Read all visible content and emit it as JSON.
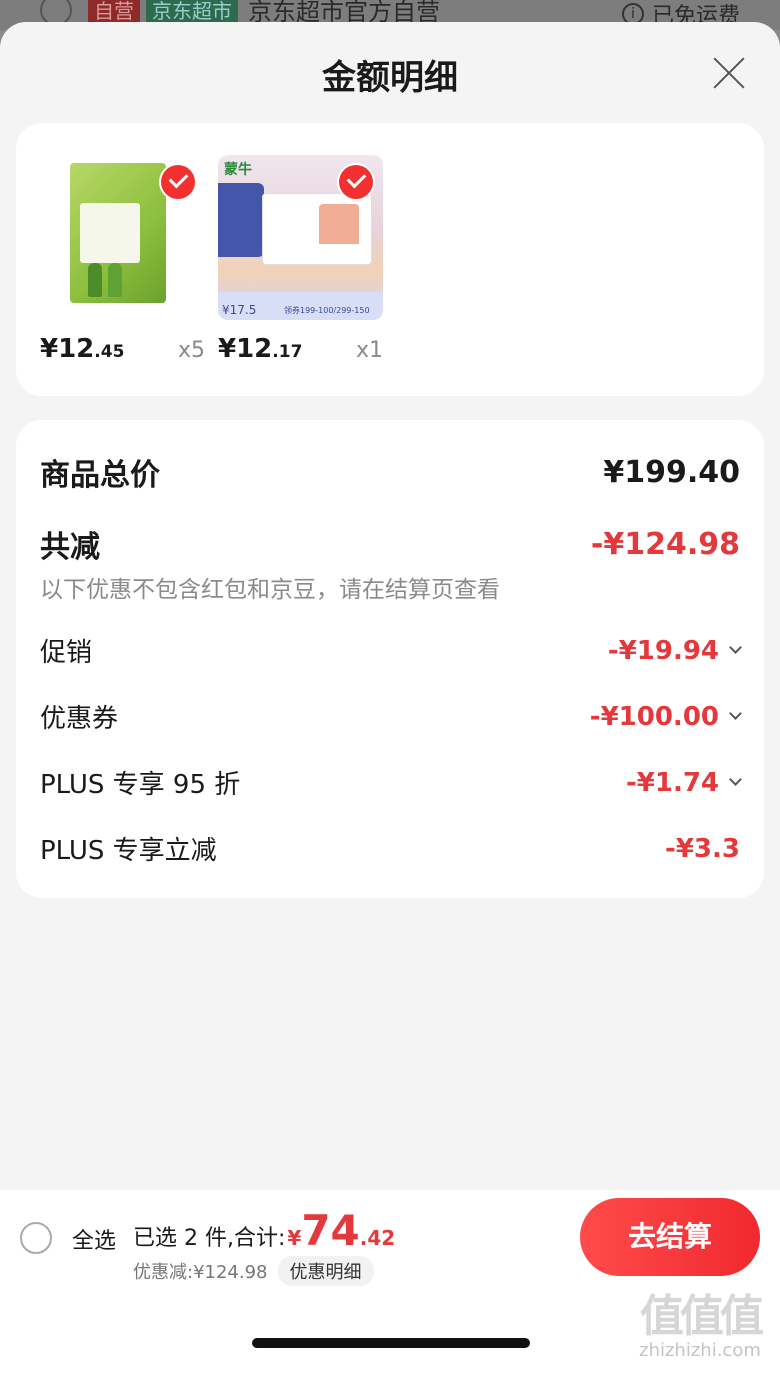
{
  "background": {
    "self_tag": "自营",
    "super_tag": "京东超市",
    "store_name": "京东超市官方自营",
    "shipping": "已免运费"
  },
  "sheet": {
    "title": "金额明细"
  },
  "products": [
    {
      "price_main": "¥12",
      "price_decimal": ".45",
      "qty": "x5"
    },
    {
      "price_main": "¥12",
      "price_decimal": ".17",
      "qty": "x1",
      "brand": "蒙牛",
      "badge_price": "¥17.5",
      "badge_text": "领券199-100/299-150"
    }
  ],
  "breakdown": {
    "total_label": "商品总价",
    "total_value": "¥199.40",
    "reduce_label": "共减",
    "reduce_value": "-¥124.98",
    "note": "以下优惠不包含红包和京豆，请在结算页查看",
    "items": [
      {
        "label": "促销",
        "value": "-¥19.94"
      },
      {
        "label": "优惠券",
        "value": "-¥100.00"
      },
      {
        "label": "PLUS 专享 95 折",
        "value": "-¥1.74"
      },
      {
        "label": "PLUS 专享立减",
        "value": "-¥3.3"
      }
    ]
  },
  "footer": {
    "select_all": "全选",
    "selected_summary": "已选 2 件,合计:",
    "total_yen": "¥",
    "total_main": "74",
    "total_decimal": ".42",
    "discount": "优惠减:¥124.98",
    "detail_link": "优惠明细",
    "checkout": "去结算"
  },
  "watermark": {
    "glyphs": "值值值",
    "text": "zhizhizhi.com"
  },
  "colors": {
    "accent_red": "#e4393c",
    "checkout_red": "#f0292f"
  }
}
